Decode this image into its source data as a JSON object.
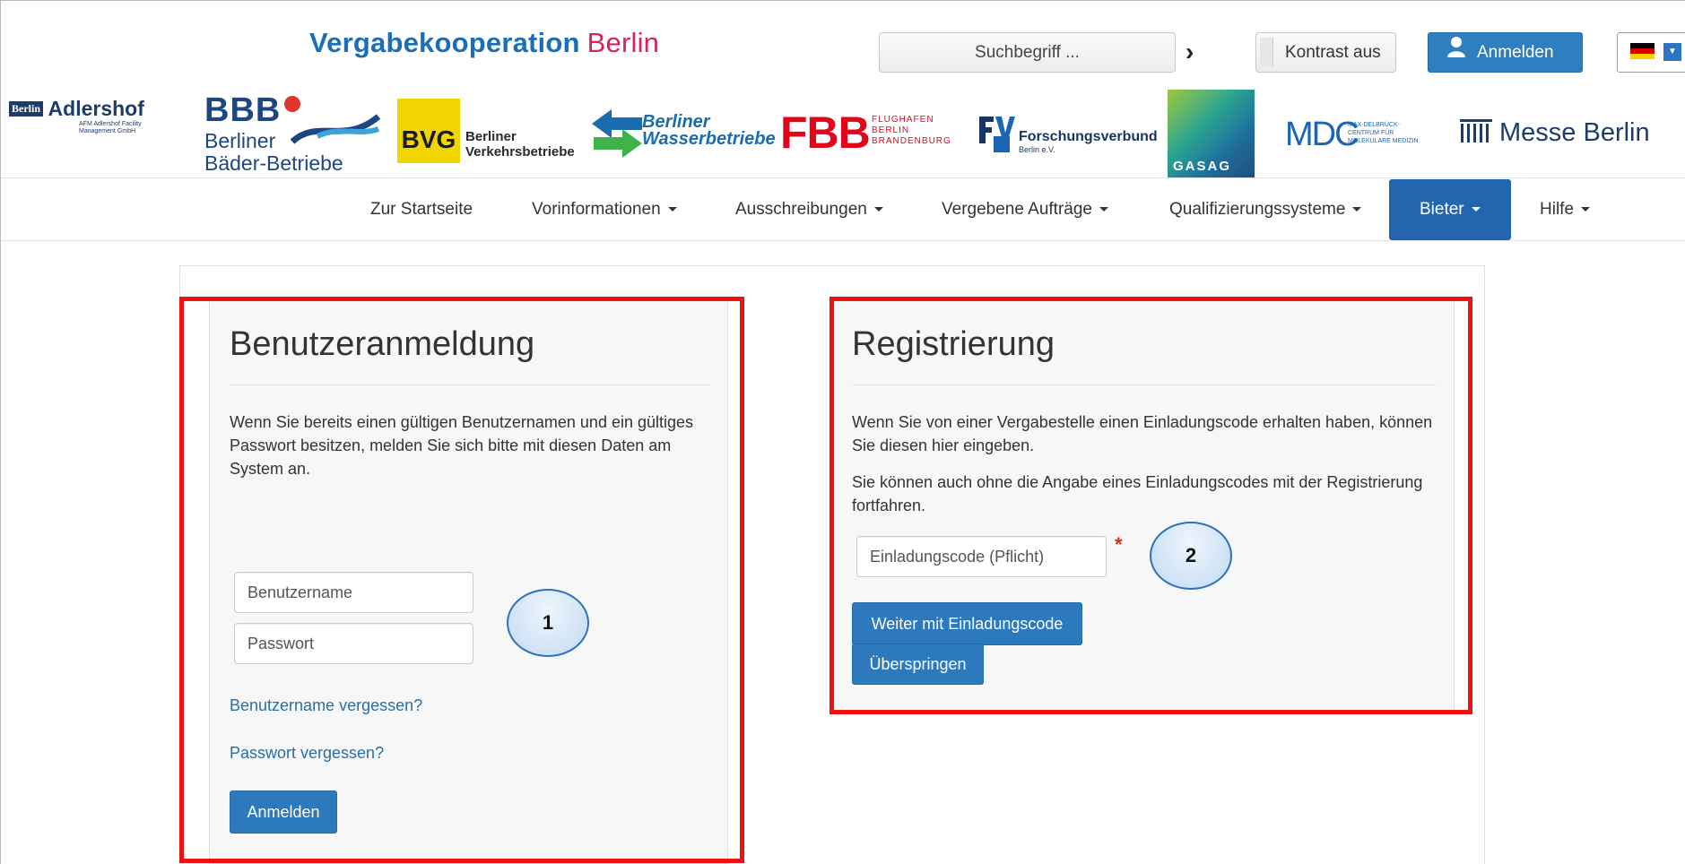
{
  "header": {
    "brand_main": "Vergabekooperation",
    "brand_city": "Berlin",
    "search_label": "Suchbegriff ...",
    "search_go": "›",
    "contrast_label": "Kontrast aus",
    "login_label": "Anmelden",
    "language_flag": "flag-de-icon"
  },
  "logos": {
    "adlershof_title": "Adlershof",
    "adlershof_box": "Berlin",
    "adlershof_sub": "AFM Adlershof Facility Management GmbH",
    "bbb_title": "BBB",
    "bbb_line1": "Berliner",
    "bbb_line2": "Bäder-Betriebe",
    "bvg_title": "BVG",
    "bvg_line1": "Berliner",
    "bvg_line2": "Verkehrsbetriebe",
    "wasser_line1": "Berliner",
    "wasser_line2": "Wasserbetriebe",
    "fbb_title": "FBB",
    "fbb_line1": "FLUGHAFEN",
    "fbb_line2": "BERLIN",
    "fbb_line3": "BRANDENBURG",
    "fv_title": "Forschungsverbund",
    "fv_sub": "Berlin e.V.",
    "gasag_title": "GASAG",
    "mdc_title": "MDC",
    "mdc_sub": "MAX-DELBRÜCK-CENTRUM FÜR MOLEKULARE MEDIZIN",
    "messe_title": "Messe Berlin"
  },
  "nav": {
    "items": [
      {
        "label": "Zur Startseite",
        "dropdown": false
      },
      {
        "label": "Vorinformationen",
        "dropdown": true
      },
      {
        "label": "Ausschreibungen",
        "dropdown": true
      },
      {
        "label": "Vergebene Aufträge",
        "dropdown": true
      },
      {
        "label": "Qualifizierungssysteme",
        "dropdown": true
      },
      {
        "label": "Bieter",
        "dropdown": true,
        "active": true
      },
      {
        "label": "Hilfe",
        "dropdown": true
      }
    ]
  },
  "login_panel": {
    "title": "Benutzeranmeldung",
    "description": "Wenn Sie bereits einen gültigen Benutzernamen und ein gültiges Passwort besitzen, melden Sie sich bitte mit diesen Daten am System an.",
    "username_placeholder": "Benutzername",
    "password_placeholder": "Passwort",
    "forgot_username": "Benutzername vergessen?",
    "forgot_password": "Passwort vergessen?",
    "submit_label": "Anmelden"
  },
  "register_panel": {
    "title": "Registrierung",
    "description1": "Wenn Sie von einer Vergabestelle einen Einladungscode erhalten haben, können Sie diesen hier eingeben.",
    "description2": "Sie können auch ohne die Angabe eines Einladungscodes mit der Registrierung fortfahren.",
    "code_placeholder": "Einladungscode (Pflicht)",
    "required_marker": "*",
    "continue_label": "Weiter mit Einladungscode",
    "skip_label": "Überspringen"
  },
  "annotations": {
    "callout1": "1",
    "callout2": "2",
    "highlight_color": "#ee1111"
  },
  "colors": {
    "primary": "#2d79bd",
    "nav_active": "#2266b0",
    "brand_blue": "#1b6fb5",
    "brand_red": "#d4245a"
  }
}
